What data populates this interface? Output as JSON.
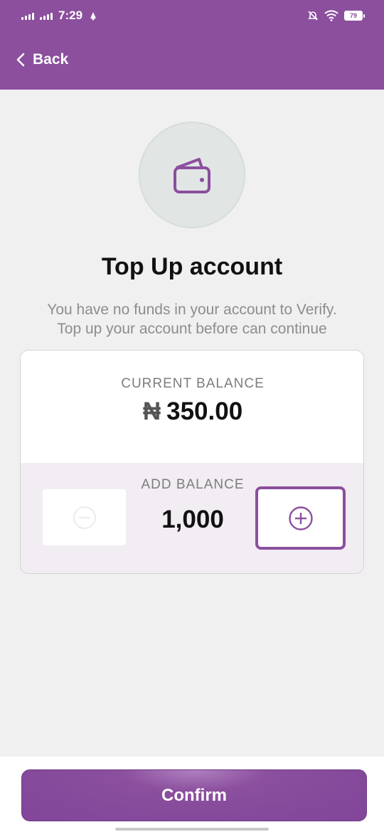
{
  "status_bar": {
    "time": "7:29",
    "battery": "79"
  },
  "header": {
    "back_label": "Back"
  },
  "main": {
    "title": "Top Up account",
    "subtitle_line1": "You have no funds in your account to Verify.",
    "subtitle_line2": "Top up your account before can continue"
  },
  "balance": {
    "current_label": "CURRENT BALANCE",
    "currency_symbol": "₦",
    "current_value": "350.00",
    "add_label": "ADD BALANCE",
    "add_value": "1,000"
  },
  "footer": {
    "confirm_label": "Confirm"
  },
  "colors": {
    "brand": "#8b4f9e",
    "background": "#f0f0f0",
    "muted_text": "#8d8d8d"
  }
}
